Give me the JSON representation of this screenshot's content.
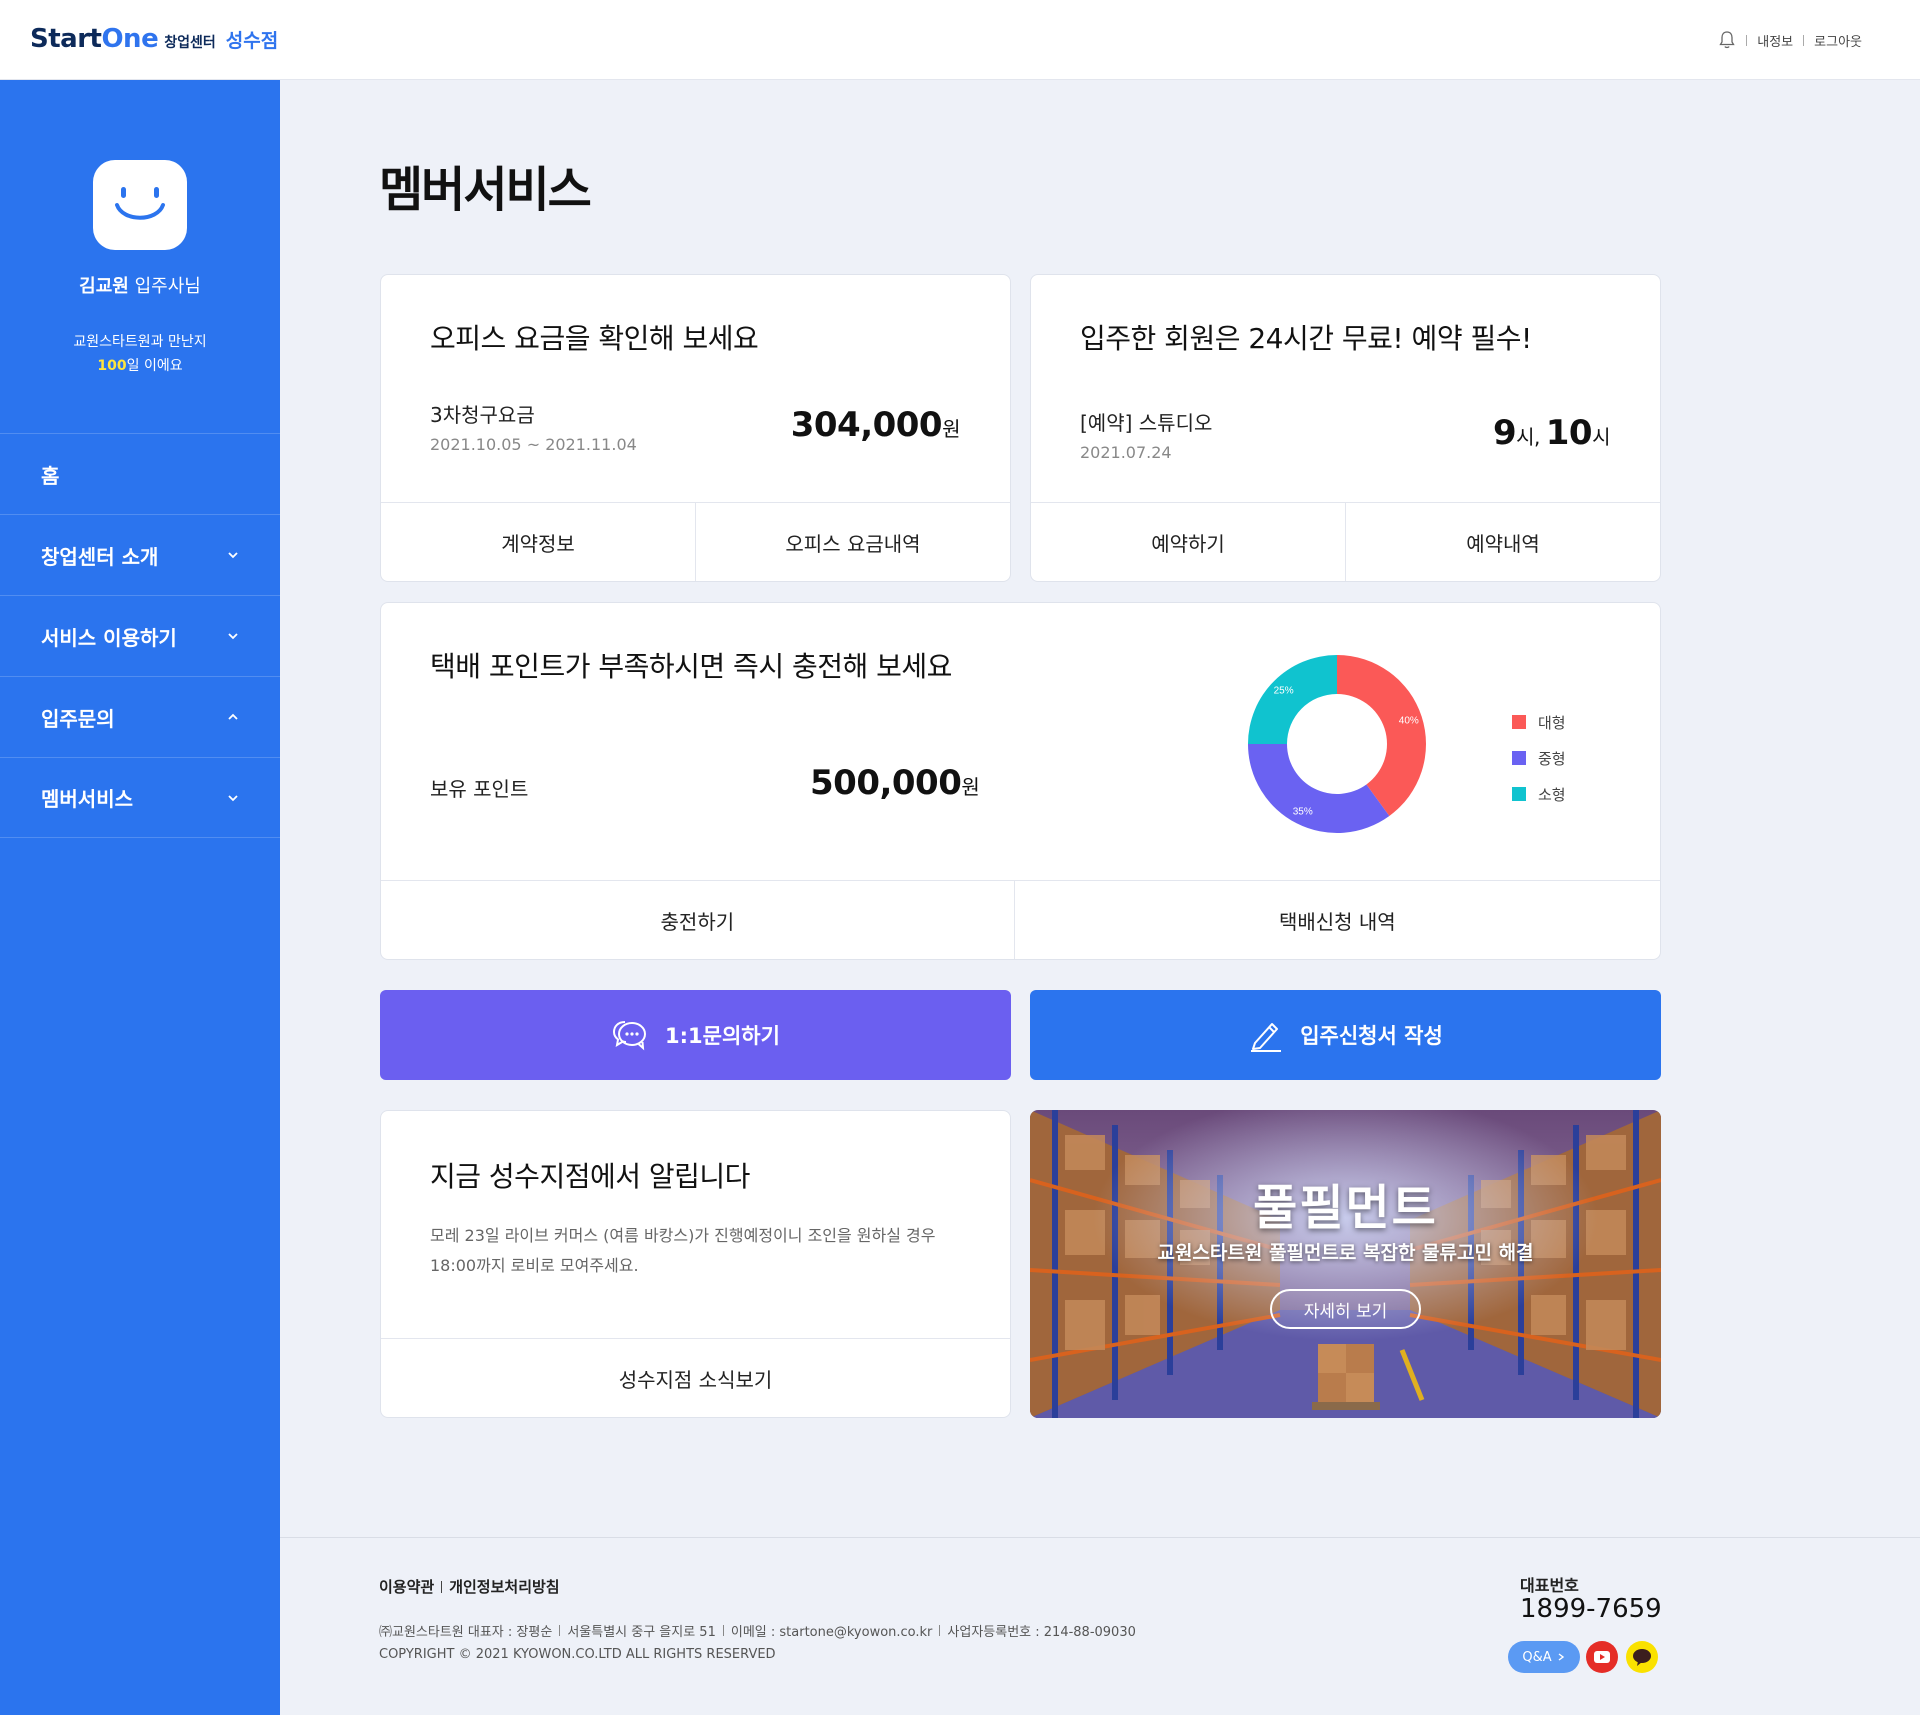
{
  "header": {
    "logo_start": "Start",
    "logo_one": "One",
    "logo_sub": "창업센터",
    "logo_branch": "성수점",
    "my_info": "내정보",
    "logout": "로그아웃"
  },
  "sidebar": {
    "user_name": "김교원",
    "user_suffix": " 입주사님",
    "days_line1": "교원스타트원과 만난지",
    "days_count": "100",
    "days_suffix": "일 이에요",
    "items": [
      {
        "label": "홈",
        "chevron": "none"
      },
      {
        "label": "창업센터 소개",
        "chevron": "down"
      },
      {
        "label": "서비스 이용하기",
        "chevron": "down"
      },
      {
        "label": "입주문의",
        "chevron": "up"
      },
      {
        "label": "멤버서비스",
        "chevron": "down"
      }
    ]
  },
  "main": {
    "page_title": "멤버서비스",
    "office_card": {
      "title": "오피스 요금을 확인해 보세요",
      "label": "3차청구요금",
      "period": "2021.10.05 ~ 2021.11.04",
      "amount": "304,000",
      "unit": "원",
      "btn1": "계약정보",
      "btn2": "오피스 요금내역"
    },
    "reserve_card": {
      "title": "입주한 회원은 24시간 무료! 예약 필수!",
      "label": "[예약] 스튜디오",
      "date": "2021.07.24",
      "time_h1": "9",
      "time_u1": "시, ",
      "time_h2": "10",
      "time_u2": "시",
      "btn1": "예약하기",
      "btn2": "예약내역"
    },
    "point_card": {
      "title": "택배 포인트가 부족하시면 즉시 충전해 보세요",
      "label": "보유 포인트",
      "amount": "500,000",
      "unit": "원",
      "btn1": "충전하기",
      "btn2": "택배신청 내역"
    },
    "action_inquiry": "1:1문의하기",
    "action_apply": "입주신청서 작성",
    "notice_card": {
      "title": "지금 성수지점에서 알립니다",
      "text": "모레 23일 라이브 커머스 (여름 바캉스)가 진행예정이니 조인을 원하실 경우18:00까지 로비로 모여주세요.",
      "btn": "성수지점 소식보기"
    },
    "promo": {
      "title": "풀필먼트",
      "desc": "교원스타트원 풀필먼트로 복잡한 물류고민 해결",
      "btn": "자세히 보기"
    }
  },
  "chart_data": {
    "type": "pie",
    "donut": true,
    "categories": [
      "대형",
      "중형",
      "소형"
    ],
    "values": [
      40,
      35,
      25
    ],
    "value_labels": [
      "40%",
      "35%",
      "25%"
    ],
    "colors": [
      "#fb5957",
      "#6a62f2",
      "#10c3cf"
    ],
    "legend_position": "right"
  },
  "footer": {
    "terms": "이용약관",
    "privacy": "개인정보처리방침",
    "company": "㈜교원스타트원 대표자 : 장평순",
    "address": "서울특별시 중구 을지로 51",
    "email": "이메일 : startone@kyowon.co.kr",
    "biz_no": "사업자등록번호 : 214-88-09030",
    "copyright": "COPYRIGHT © 2021 KYOWON.CO.LTD ALL RIGHTS RESERVED",
    "tel_label": "대표번호",
    "tel": "1899-7659",
    "qa_label": "Q&A"
  },
  "colors": {
    "sidebar": "#2b74ee",
    "inquiry_button": "#6b5ff0",
    "apply_button": "#2b74ee",
    "highlight": "#ffe53d"
  }
}
